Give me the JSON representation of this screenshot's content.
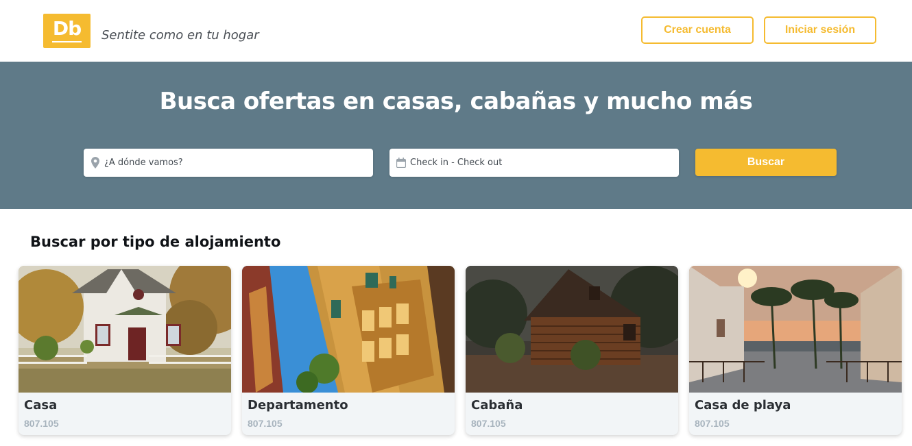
{
  "header": {
    "logo_text": "Db",
    "tagline": "Sentite como en tu hogar",
    "create_account_label": "Crear cuenta",
    "login_label": "Iniciar sesión"
  },
  "hero": {
    "title": "Busca ofertas en casas, cabañas y mucho más",
    "destination_placeholder": "¿A dónde vamos?",
    "dates_placeholder": "Check in - Check out",
    "search_label": "Buscar"
  },
  "categories": {
    "title": "Buscar por tipo de alojamiento",
    "items": [
      {
        "label": "Casa",
        "count": "807.105"
      },
      {
        "label": "Departamento",
        "count": "807.105"
      },
      {
        "label": "Cabaña",
        "count": "807.105"
      },
      {
        "label": "Casa de playa",
        "count": "807.105"
      }
    ]
  },
  "colors": {
    "brand": "#f5bb30",
    "hero_bg": "#5f7a88",
    "card_bg": "#f2f5f7",
    "count_text": "#a7b3bd"
  },
  "icons": {
    "destination": "map-pin-icon",
    "dates": "calendar-icon"
  }
}
